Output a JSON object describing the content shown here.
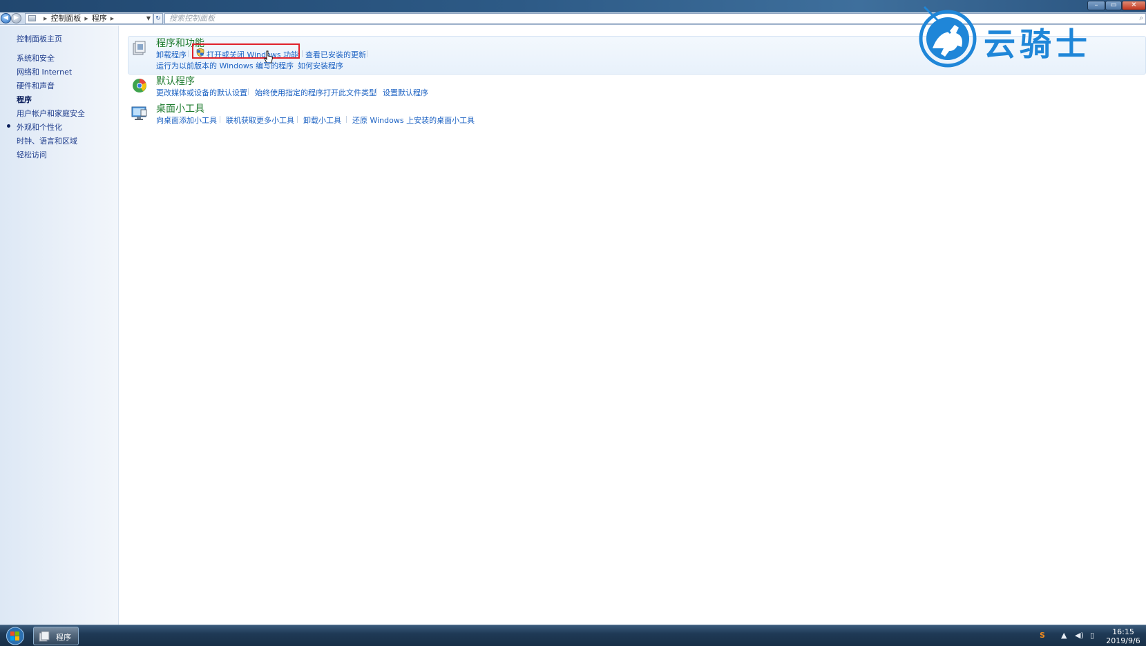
{
  "window": {
    "minimize_glyph": "–",
    "maximize_glyph": "▭",
    "close_glyph": "✕"
  },
  "address": {
    "crumbs": [
      "控制面板",
      "程序"
    ],
    "search_placeholder": "搜索控制面板"
  },
  "sidebar": {
    "items": [
      {
        "label": "控制面板主页",
        "current": false
      },
      {
        "label": "系统和安全",
        "current": false
      },
      {
        "label": "网络和 Internet",
        "current": false
      },
      {
        "label": "硬件和声音",
        "current": false
      },
      {
        "label": "程序",
        "current": true
      },
      {
        "label": "用户帐户和家庭安全",
        "current": false
      },
      {
        "label": "外观和个性化",
        "current": false
      },
      {
        "label": "时钟、语言和区域",
        "current": false
      },
      {
        "label": "轻松访问",
        "current": false
      }
    ]
  },
  "categories": [
    {
      "title": "程序和功能",
      "icon": "programs-features-icon",
      "links_row1": [
        "卸载程序",
        "打开或关闭 Windows 功能",
        "查看已安装的更新"
      ],
      "links_row2": [
        "运行为以前版本的 Windows 编写的程序",
        "如何安装程序"
      ]
    },
    {
      "title": "默认程序",
      "icon": "default-programs-icon",
      "links_row1": [
        "更改媒体或设备的默认设置",
        "始终使用指定的程序打开此文件类型",
        "设置默认程序"
      ]
    },
    {
      "title": "桌面小工具",
      "icon": "desktop-gadgets-icon",
      "links_row1": [
        "向桌面添加小工具",
        "联机获取更多小工具",
        "卸载小工具",
        "还原 Windows 上安装的桌面小工具"
      ]
    }
  ],
  "watermark": {
    "text": "云骑士",
    "color": "#1f86d8"
  },
  "taskbar": {
    "active_task": "程序",
    "time": "16:15",
    "date": "2019/9/6"
  },
  "colors": {
    "link": "#1e63c3",
    "category_title": "#1e7b2e",
    "highlight_box": "#e0202a"
  }
}
